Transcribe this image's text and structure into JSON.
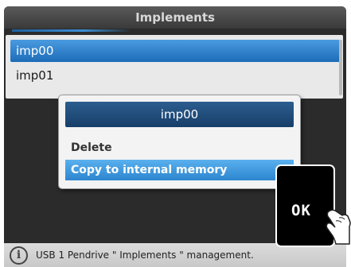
{
  "window": {
    "title": "Implements"
  },
  "list": {
    "items": [
      {
        "label": "imp00",
        "selected": true
      },
      {
        "label": "imp01",
        "selected": false
      }
    ]
  },
  "dialog": {
    "title": "imp00",
    "options": [
      {
        "label": "Delete",
        "highlighted": false
      },
      {
        "label": "Copy to internal memory",
        "highlighted": true
      }
    ]
  },
  "status_bar": {
    "icon": "info-icon",
    "text": "USB 1 Pendrive \" Implements \" management."
  },
  "ok_key": {
    "label": "OK"
  },
  "colors": {
    "accent": "#1d6cb8",
    "highlight": "#2c85cf",
    "dialog_header": "#173e69"
  }
}
